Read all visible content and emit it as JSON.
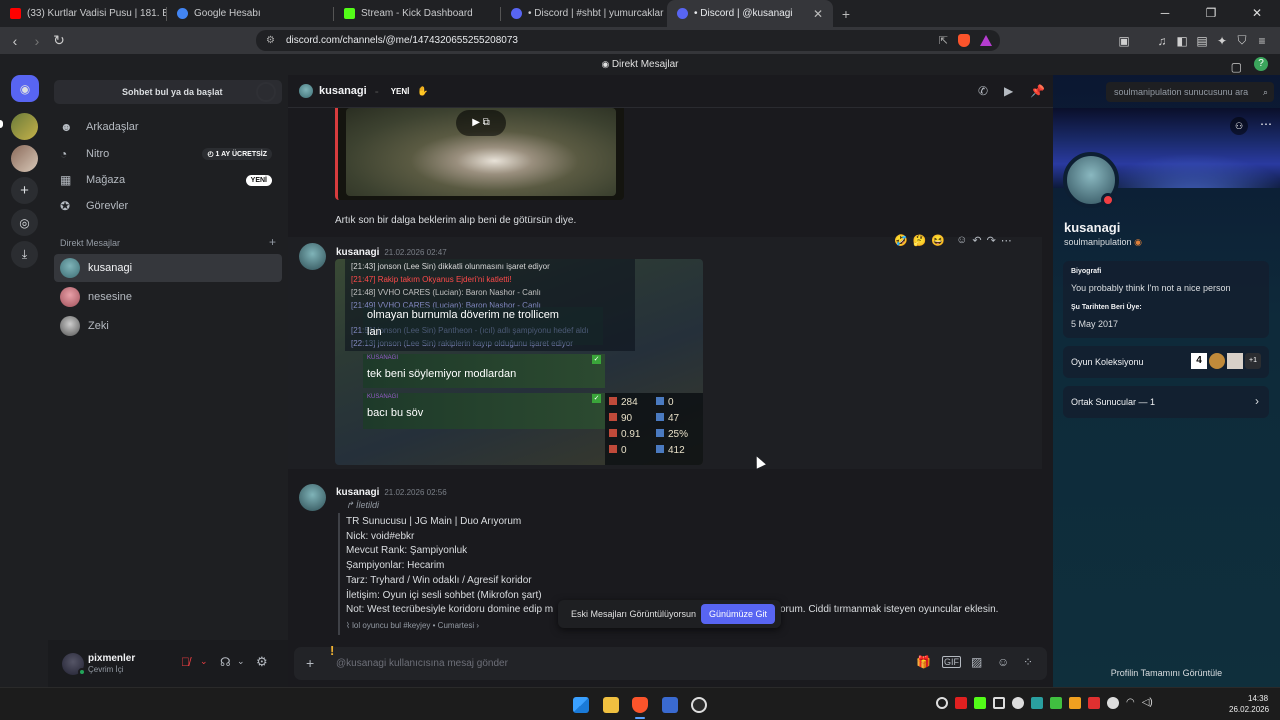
{
  "browser": {
    "tabs": [
      {
        "title": "(33) Kurtlar Vadisi Pusu | 181. Bölüm |",
        "color": "#ff0000"
      },
      {
        "title": "Google Hesabı",
        "color": "#4285f4"
      },
      {
        "title": "Stream - Kick Dashboard",
        "color": "#53fc18"
      },
      {
        "title": "• Discord | #shbt | yumurcaklar",
        "color": "#5865f2"
      },
      {
        "title": "• Discord | @kusanagi",
        "color": "#5865f2"
      }
    ],
    "url": "discord.com/channels/@me/1474320655255208073"
  },
  "app": {
    "window_title": "Direkt Mesajlar"
  },
  "dm_panel": {
    "search_placeholder": "Sohbet bul ya da başlat",
    "nav": [
      {
        "label": "Arkadaşlar",
        "icon": "friends-icon"
      },
      {
        "label": "Nitro",
        "icon": "nitro-icon",
        "badge": "1 AY ÜCRETSİZ"
      },
      {
        "label": "Mağaza",
        "icon": "shop-icon",
        "badge": "YENİ"
      },
      {
        "label": "Görevler",
        "icon": "quests-icon"
      }
    ],
    "section_title": "Direkt Mesajlar",
    "dms": [
      {
        "name": "kusanagi",
        "color": "#3d6e74"
      },
      {
        "name": "nesesine",
        "color": "#c46b74"
      },
      {
        "name": "Zeki",
        "color": "#8a8a8a"
      }
    ]
  },
  "user": {
    "name": "pixmenler",
    "status": "Çevrim İçi"
  },
  "chat": {
    "header_name": "kusanagi",
    "header_badge": "YENİ",
    "search_placeholder": "soulmanipulation sunucusunu ara",
    "messages": [
      {
        "text": "Artık son bir dalga beklerim alıp beni de götürsün diye."
      },
      {
        "author": "kusanagi",
        "time": "21.02.2026 02:47"
      },
      {
        "author": "kusanagi",
        "time": "21.02.2026 02:56",
        "forwarded_label": "İletildi",
        "lines": [
          "TR Sunucusu | JG Main | Duo Arıyorum",
          "Nick: void#ebkr",
          "Mevcut Rank: Şampiyonluk",
          "Şampiyonlar: Hecarim",
          "Tarz: Tryhard / Win odaklı / Agresif koridor",
          "İletişim: Oyun içi sesli sohbet (Mikrofon şart)",
          "Not: West tecrübesiyle koridoru domine edip m"
        ],
        "line_tail": "orum. Ciddi tırmanmak isteyen  oyuncular eklesin.",
        "source": "lol oyuncu bul #keyjey",
        "source_day": "Cumartesi"
      }
    ],
    "game_log": [
      {
        "text": "[21:43] jonson (Lee Sin)  dikkatli olunmasını işaret ediyor"
      },
      {
        "text": "[21:47] Rakip takım Okyanus Ejderi'ni katletti!"
      },
      {
        "text": "[21:48] VVHO CARES (Lucian): Baron Nashor - Canlı"
      },
      {
        "text": "[21:49] VVHO CARES (Lucian): Baron Nashor - Canlı"
      },
      {
        "text": "[21:51] jonson (Lee Sin) Pantheon - (ıcıl) adlı şampiyonu hedef aldı"
      },
      {
        "text": "[22:13] jonson (Lee Sin) rakiplerin kayıp olduğunu işaret ediyor"
      }
    ],
    "overlay_lines": [
      "olmayan burnumla döverim ne trollicem",
      "lan"
    ],
    "game_chat": [
      {
        "tag": "KUSANAGI",
        "text": "tek beni söylemiyor modlardan"
      },
      {
        "tag": "KUSANAGI",
        "text": "bacı bu söv"
      }
    ],
    "stats": {
      "left": [
        "284",
        "90",
        "0.91",
        "0"
      ],
      "right": [
        "0",
        "47",
        "25%",
        "412"
      ]
    },
    "old_banner": "Eski Mesajları Görüntülüyorsun",
    "old_banner_btn": "Günümüze Git",
    "composer_placeholder": "@kusanagi kullanıcısına mesaj gönder"
  },
  "profile": {
    "name": "kusanagi",
    "username": "soulmanipulation",
    "bio_title": "Biyografi",
    "bio": "You probably think I'm not a nice person",
    "member_since_title": "Şu Tarihten Beri Üye:",
    "member_since": "5 May 2017",
    "games_title": "Oyun Koleksiyonu",
    "games_more": "+1",
    "servers_title": "Ortak Sunucular — 1",
    "full_profile": "Profilin Tamamını Görüntüle"
  },
  "taskbar": {
    "time": "14:38",
    "date": "26.02.2026"
  }
}
